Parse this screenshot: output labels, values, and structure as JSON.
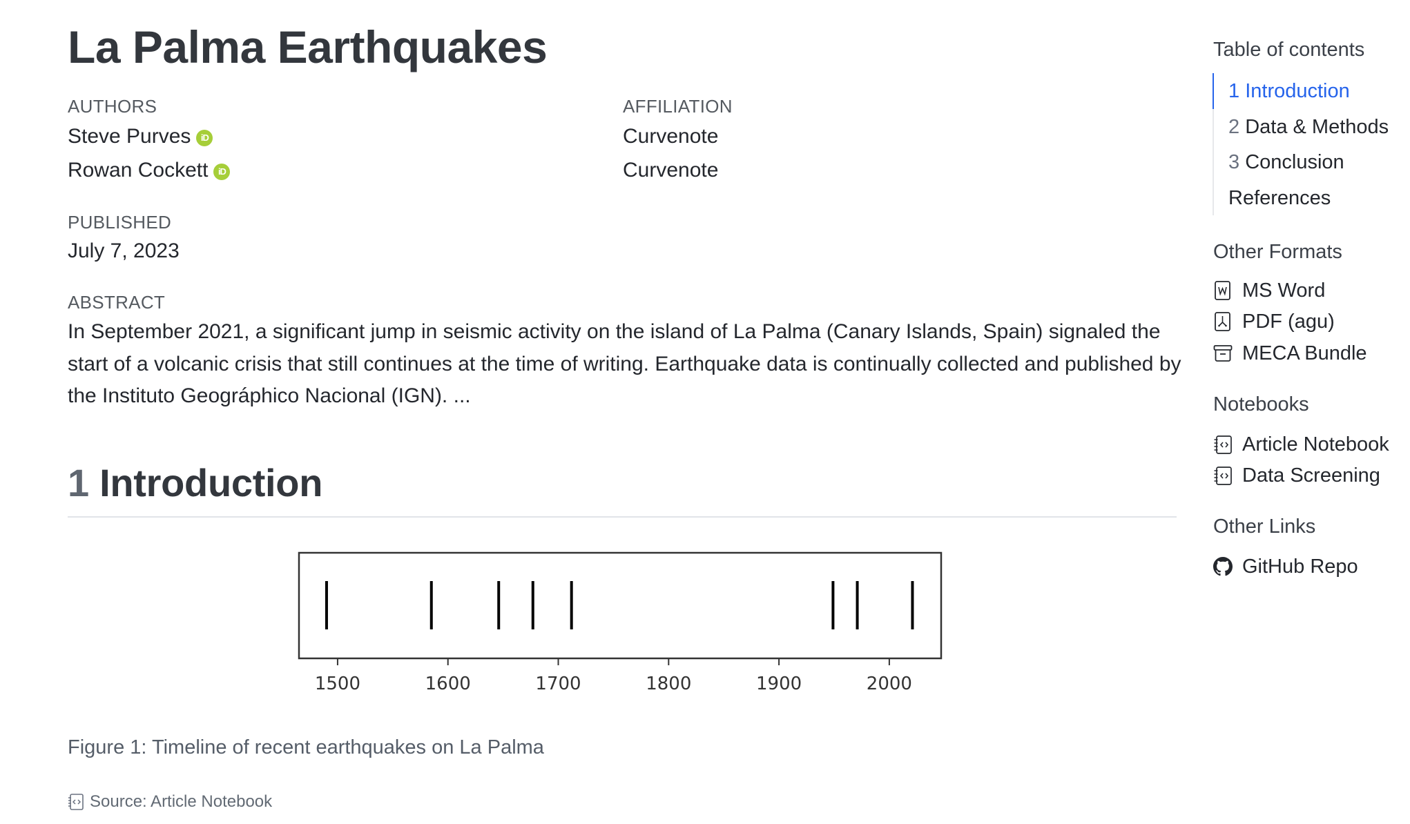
{
  "article": {
    "title": "La Palma Earthquakes",
    "authors_label": "AUTHORS",
    "affiliation_label": "AFFILIATION",
    "authors": [
      {
        "name": "Steve Purves",
        "affiliation": "Curvenote",
        "orcid_icon": "orcid-icon",
        "orcid_glyph": "iD"
      },
      {
        "name": "Rowan Cockett",
        "affiliation": "Curvenote",
        "orcid_icon": "orcid-icon",
        "orcid_glyph": "iD"
      }
    ],
    "published_label": "PUBLISHED",
    "published_date": "July 7, 2023",
    "abstract_label": "ABSTRACT",
    "abstract_text": "In September 2021, a significant jump in seismic activity on the island of La Palma (Canary Islands, Spain) signaled the start of a volcanic crisis that still continues at the time of writing. Earthquake data is continually collected and published by the Instituto Geográphico Nacional (IGN). ...",
    "section": {
      "number": "1",
      "title": "Introduction"
    },
    "figure": {
      "caption": "Figure 1: Timeline of recent earthquakes on La Palma",
      "source_label": "Source: Article Notebook",
      "source_icon": "notebook-icon"
    }
  },
  "sidebar": {
    "toc_heading": "Table of contents",
    "toc": [
      {
        "number": "1",
        "label": "Introduction",
        "active": true
      },
      {
        "number": "2",
        "label": "Data & Methods",
        "active": false
      },
      {
        "number": "3",
        "label": "Conclusion",
        "active": false
      },
      {
        "number": "",
        "label": "References",
        "active": false
      }
    ],
    "formats_heading": "Other Formats",
    "formats": [
      {
        "label": "MS Word",
        "icon": "word-file-icon"
      },
      {
        "label": "PDF (agu)",
        "icon": "pdf-file-icon"
      },
      {
        "label": "MECA Bundle",
        "icon": "archive-box-icon"
      }
    ],
    "notebooks_heading": "Notebooks",
    "notebooks": [
      {
        "label": "Article Notebook",
        "icon": "notebook-icon"
      },
      {
        "label": "Data Screening",
        "icon": "notebook-icon"
      }
    ],
    "links_heading": "Other Links",
    "links": [
      {
        "label": "GitHub Repo",
        "icon": "github-icon"
      }
    ]
  },
  "colors": {
    "accent": "#2563eb",
    "orcid": "#a6ce39",
    "text": "#24272d",
    "muted": "#555a60"
  },
  "chart_data": {
    "type": "eventplot",
    "title": "",
    "xlabel": "",
    "ylabel": "",
    "x": [
      1490,
      1585,
      1646,
      1677,
      1712,
      1949,
      1971,
      2021
    ],
    "xlim": [
      1465,
      2047
    ],
    "xticks": [
      1500,
      1600,
      1700,
      1800,
      1900,
      2000
    ],
    "xtick_labels": [
      "1500",
      "1600",
      "1700",
      "1800",
      "1900",
      "2000"
    ],
    "yticks": [],
    "grid": false,
    "legend": "none",
    "line_color": "#000000"
  }
}
